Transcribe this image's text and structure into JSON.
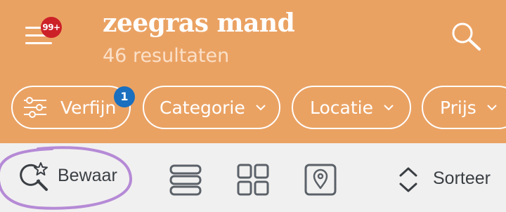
{
  "header": {
    "title": "zeegras mand",
    "subtitle": "46 resultaten",
    "menu_badge": "99+",
    "menu_icon": "hamburger-menu-icon",
    "search_icon": "search-icon",
    "background_color": "#eaa263",
    "badge_color": "#cd2128"
  },
  "filters": {
    "refine": {
      "label": "Verfijn",
      "count": "1",
      "icon": "sliders-icon"
    },
    "category": {
      "label": "Categorie",
      "icon": "chevron-down-icon"
    },
    "location": {
      "label": "Locatie",
      "icon": "chevron-down-icon"
    },
    "price": {
      "label": "Prijs",
      "icon": "chevron-down-icon"
    },
    "count_badge_color": "#1a6fbe"
  },
  "toolbar": {
    "save_label": "Bewaar",
    "save_icon": "magnifier-star-icon",
    "list_view_icon": "list-view-icon",
    "grid_view_icon": "grid-view-icon",
    "map_view_icon": "map-pin-icon",
    "sort_label": "Sorteer",
    "sort_icon": "sort-updown-icon",
    "highlight_color": "#b58ad6"
  }
}
